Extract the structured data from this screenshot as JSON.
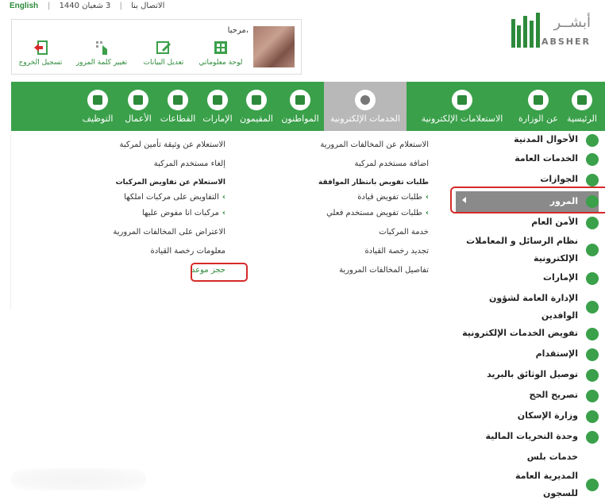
{
  "topbar": {
    "language": "English",
    "contact": "الاتصال بنا",
    "date": "3 شعبان 1440"
  },
  "user": {
    "greeting": "مرحبا،",
    "buttons": [
      {
        "label": "لوحة معلوماتي",
        "icon": "dashboard-icon"
      },
      {
        "label": "تعديل البيانات",
        "icon": "edit-icon"
      },
      {
        "label": "تغيير كلمة المرور",
        "icon": "password-icon"
      },
      {
        "label": "تسجيل الخروج",
        "icon": "logout-icon"
      }
    ]
  },
  "logo": {
    "arabic": "أبشــر",
    "english": "ABSHER"
  },
  "nav": {
    "items": [
      {
        "label": "الرئيسية",
        "icon": "home-icon"
      },
      {
        "label": "عن الوزارة",
        "icon": "ministry-icon"
      },
      {
        "label": "الاستعلامات الإلكترونية",
        "icon": "inquiry-icon"
      },
      {
        "label": "الخدمات الإلكترونية",
        "icon": "globe-icon",
        "active": true
      },
      {
        "label": "المواطنون",
        "icon": "citizen-icon"
      },
      {
        "label": "المقيمون",
        "icon": "residents-icon"
      },
      {
        "label": "الإمارات",
        "icon": "emirates-icon"
      },
      {
        "label": "القطاعات",
        "icon": "sectors-icon"
      },
      {
        "label": "الأعمال",
        "icon": "business-icon"
      },
      {
        "label": "التوظيف",
        "icon": "employment-icon"
      }
    ]
  },
  "menu": {
    "col1": [
      "الاستعلام عن المخالفات المرورية",
      "اضافة مستخدم لمركبة",
      "طلبات تفويض بانتظار الموافقة",
      "طلبات تفويض قيادة",
      "طلبات تفويض مستخدم فعلي",
      "خدمة المركبات",
      "تجديد رخصة القيادة",
      "تفاصيل المخالفات المرورية"
    ],
    "col2": [
      "الاستعلام عن وثيقة تأمين لمركبة",
      "إلغاء مستخدم المركبة",
      "الاستعلام عن تفاويض المركبات",
      "التفاويض على مركبات املكها",
      "مركبات انا مفوض عليها",
      "الاعتراض على المخالفات المرورية",
      "معلومات رخصة القيادة",
      "حجز موعد"
    ]
  },
  "sidebar": {
    "items": [
      "الأحوال المدنية",
      "الخدمات العامة",
      "الجوازات",
      "المرور",
      "الأمن العام",
      "نظام الرسائل و المعاملات",
      "الإلكترونية",
      "الإمارات",
      "الإدارة العامة لشؤون",
      "الوافدين",
      "تفويض الخدمات الإلكترونية",
      "الإستقدام",
      "توصيل الوثائق بالبريد",
      "تصريح الحج",
      "وزارة الإسكان",
      "وحدة التحريات المالية",
      "خدمات بلس",
      "المديرية العامة",
      "للسجون"
    ]
  }
}
